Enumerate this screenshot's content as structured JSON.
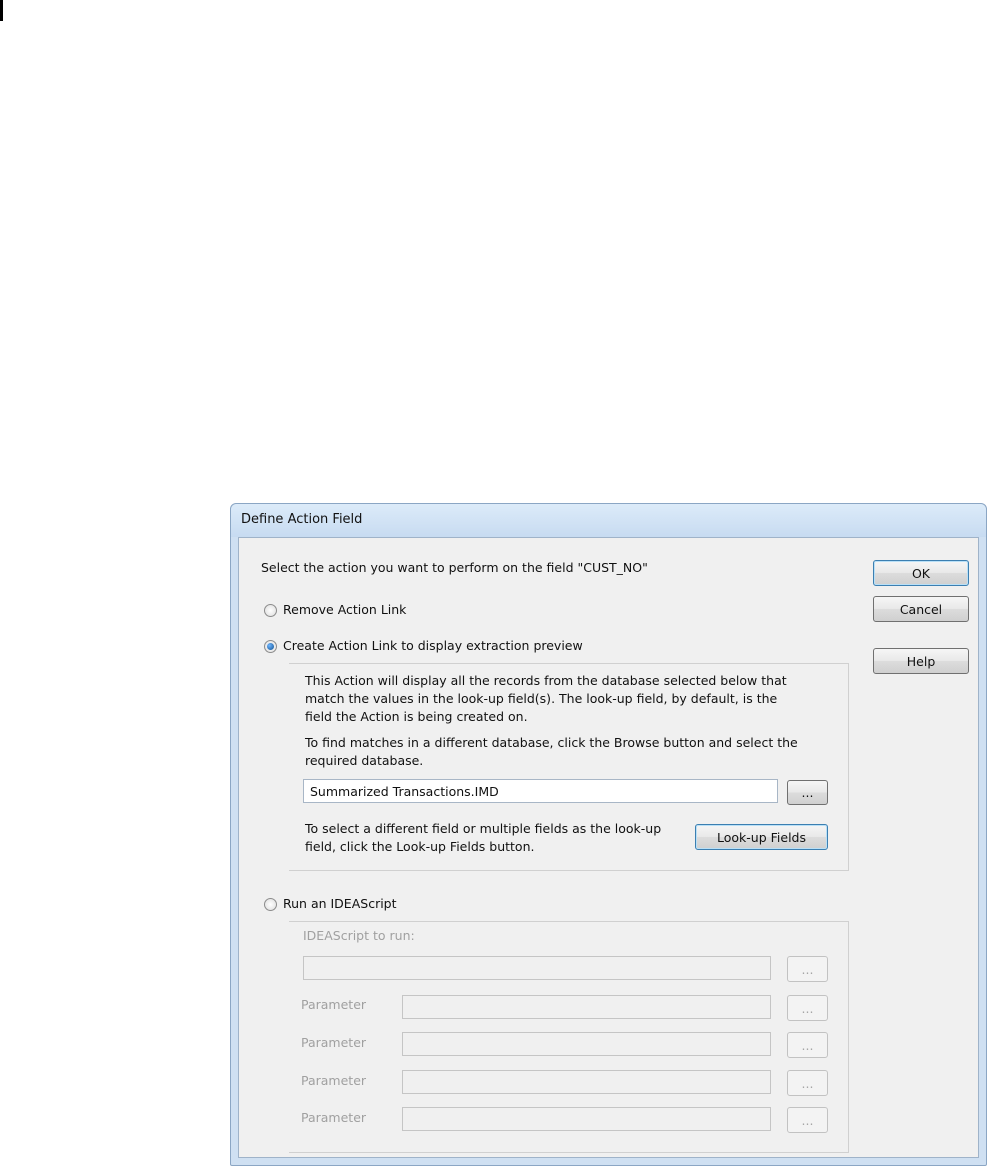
{
  "dialog": {
    "title": "Define Action Field",
    "instruction": "Select the action you want to perform on the field \"CUST_NO\"",
    "buttons": {
      "ok": "OK",
      "cancel": "Cancel",
      "help": "Help"
    }
  },
  "options": {
    "remove": {
      "label": "Remove Action Link",
      "selected": false
    },
    "extraction": {
      "label": "Create Action Link to display extraction preview",
      "selected": true,
      "description": [
        "This Action will display all the records from the database selected below that",
        "match the values in the look-up field(s).  The look-up field, by default, is the",
        "field the Action is being created on."
      ],
      "browse_hint": [
        "To find matches in a different database, click the Browse button and select the",
        "required database."
      ],
      "database_value": "Summarized Transactions.IMD",
      "browse_label": "...",
      "lookup_hint": [
        "To select a different field or multiple fields as the look-up",
        "field, click the Look-up Fields button."
      ],
      "lookup_button": "Look-up Fields"
    },
    "script": {
      "label": "Run an IDEAScript",
      "selected": false,
      "script_label": "IDEAScript to run:",
      "script_value": "",
      "browse_label": "...",
      "parameters": [
        {
          "label": "Parameter",
          "value": ""
        },
        {
          "label": "Parameter",
          "value": ""
        },
        {
          "label": "Parameter",
          "value": ""
        },
        {
          "label": "Parameter",
          "value": ""
        }
      ]
    }
  }
}
